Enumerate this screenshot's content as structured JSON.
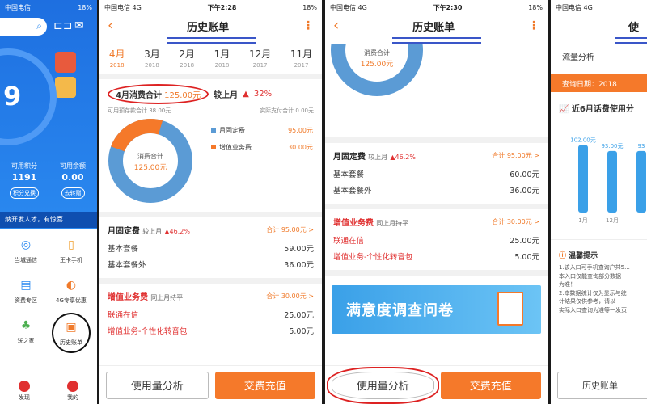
{
  "panel1": {
    "status": {
      "carrier": "中国电信",
      "net": "4G",
      "battery": "18%"
    },
    "big_number": "9",
    "stat_left": {
      "label": "可用积分",
      "value": "1191",
      "button": "积分兑换"
    },
    "stat_right": {
      "label": "可用余额",
      "value": "0.00",
      "button": "去转赠"
    },
    "banner": "纳开发人才，有惊喜",
    "menu": [
      {
        "icon": "globe-icon",
        "label": "当城通信"
      },
      {
        "icon": "phone-icon",
        "label": "王卡手机"
      },
      {
        "icon": "doc-icon",
        "label": "资费专区"
      },
      {
        "icon": "circle-icon",
        "label": "4G专享优惠"
      },
      {
        "icon": "leaf-icon",
        "label": "沃之家"
      },
      {
        "icon": "bill-icon",
        "label": "历史账单"
      }
    ],
    "tabbar": [
      {
        "label": "发现"
      },
      {
        "label": "我的"
      }
    ]
  },
  "panel2": {
    "status": {
      "carrier": "中国电信",
      "net": "4G",
      "time": "下午2:28",
      "battery": "18%"
    },
    "title": "历史账单",
    "months": [
      {
        "m": "4月",
        "y": "2018",
        "active": true
      },
      {
        "m": "3月",
        "y": "2018"
      },
      {
        "m": "2月",
        "y": "2018"
      },
      {
        "m": "1月",
        "y": "2018"
      },
      {
        "m": "12月",
        "y": "2017"
      },
      {
        "m": "11月",
        "y": "2017"
      }
    ],
    "summary": {
      "label": "4月消费合计",
      "amount": "125.00元",
      "compare": "较上月",
      "trend": "32%"
    },
    "sub_line_left": "可用预存款合计 38.00元",
    "sub_line_right": "实际支付合计 0.00元",
    "donut": {
      "center_label": "消费合计",
      "center_value": "125.00元"
    },
    "legend": [
      {
        "name": "月固定费",
        "value": "95.00元",
        "color": "#5b9bd5"
      },
      {
        "name": "增值业务费",
        "value": "30.00元",
        "color": "#f5792a"
      }
    ],
    "fixed": {
      "title": "月固定费",
      "compare": "较上月",
      "trend": "46.2%",
      "total": "合计 95.00元 >",
      "rows": [
        {
          "name": "基本套餐",
          "value": "59.00元"
        },
        {
          "name": "基本套餐外",
          "value": "36.00元"
        }
      ]
    },
    "vas": {
      "title": "增值业务费",
      "compare": "同上月持平",
      "total": "合计 30.00元 >",
      "rows": [
        {
          "name": "联通在信",
          "value": "25.00元"
        },
        {
          "name": "增值业务-个性化转音包",
          "value": "5.00元"
        }
      ]
    },
    "btn_left": "使用量分析",
    "btn_right": "交费充值"
  },
  "panel3": {
    "status": {
      "carrier": "中国电信",
      "net": "4G",
      "time": "下午2:30",
      "battery": "18%"
    },
    "title": "历史账单",
    "donut_label": "消费合计",
    "donut_value": "125.00元",
    "fixed": {
      "title": "月固定费",
      "compare": "较上月",
      "trend": "46.2%",
      "total": "合计 95.00元 >",
      "rows": [
        {
          "name": "基本套餐",
          "value": "60.00元"
        },
        {
          "name": "基本套餐外",
          "value": "36.00元"
        }
      ]
    },
    "vas": {
      "title": "增值业务费",
      "compare": "同上月持平",
      "total": "合计 30.00元 >",
      "rows": [
        {
          "name": "联通在信",
          "value": "25.00元"
        },
        {
          "name": "增值业务-个性化转音包",
          "value": "5.00元"
        }
      ]
    },
    "survey_banner": "满意度调查问卷",
    "btn_left": "使用量分析",
    "btn_right": "交费充值"
  },
  "panel4": {
    "status": {
      "carrier": "中国电信",
      "net": "4G"
    },
    "title": "使",
    "tab": "流量分析",
    "date_bar": "查询日期：2018",
    "chart_title": "近6月话费使用分",
    "chart_data": {
      "type": "bar",
      "categories": [
        "1月",
        "12月",
        ""
      ],
      "values": [
        102.0,
        93.0,
        93.0
      ],
      "title": "近6月话费使用分",
      "xlabel": "",
      "ylabel": ""
    },
    "bar_labels": [
      "102.00元",
      "93.00元",
      "93"
    ],
    "tips_title": "温馨提示",
    "tips": [
      "1.该入口可手机查询户共5...",
      "本入口仅能查询部分数据",
      "为准！",
      "2.本数据统计仅为显示与统",
      "计结果仅供参考，请以",
      "实际入口查询为准等一发页"
    ],
    "btn": "历史账单"
  }
}
